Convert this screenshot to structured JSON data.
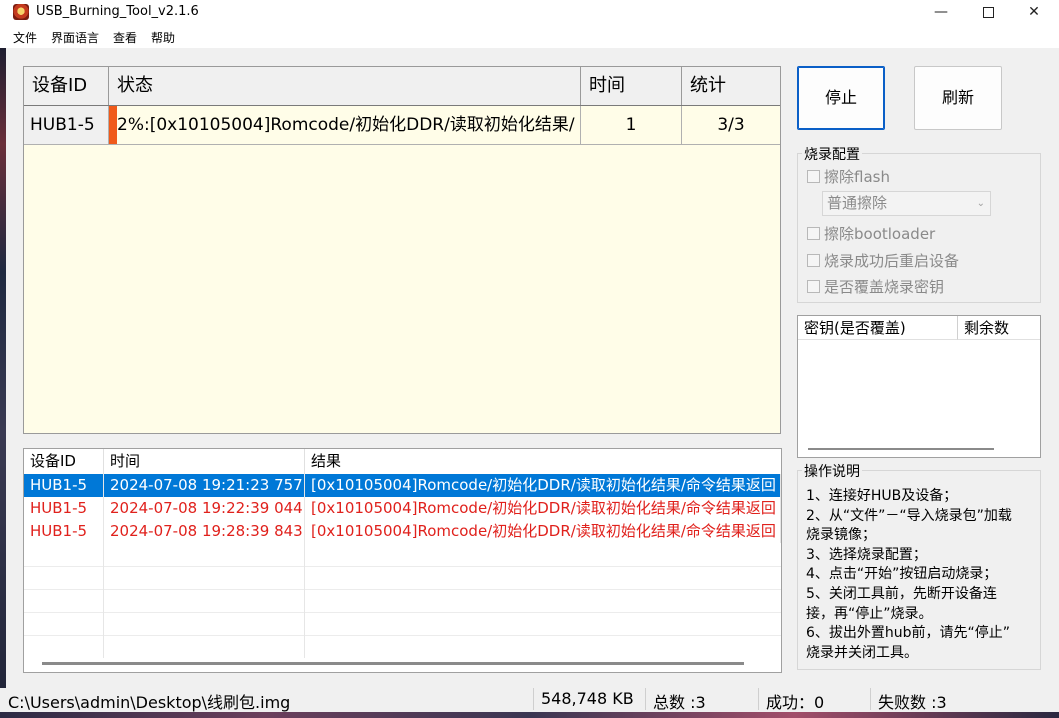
{
  "window": {
    "title": "USB_Burning_Tool_v2.1.6",
    "minimize": "—",
    "close": "✕"
  },
  "menu": [
    "文件",
    "界面语言",
    "查看",
    "帮助"
  ],
  "device_grid": {
    "headers": [
      "设备ID",
      "状态",
      "时间",
      "统计"
    ],
    "row": {
      "id": "HUB1-5",
      "status": "2%:[0x10105004]Romcode/初始化DDR/读取初始化结果/",
      "time": "1",
      "stats": "3/3"
    }
  },
  "buttons": {
    "stop": "停止",
    "refresh": "刷新"
  },
  "burn_config": {
    "title": "烧录配置",
    "erase_flash": "擦除flash",
    "erase_mode": "普通擦除",
    "erase_bootloader": "擦除bootloader",
    "reboot_after": "烧录成功后重启设备",
    "overwrite_key": "是否覆盖烧录密钥"
  },
  "key_table": {
    "headers": [
      "密钥(是否覆盖)",
      "剩余数"
    ]
  },
  "instructions": {
    "title": "操作说明",
    "lines": [
      "1、连接好HUB及设备；",
      "2、从“文件”－“导入烧录包”加载",
      "烧录镜像；",
      "3、选择烧录配置；",
      "4、点击“开始”按钮启动烧录；",
      "5、关闭工具前，先断开设备连",
      "接，再“停止”烧录。",
      "6、拔出外置hub前，请先“停止”",
      "烧录并关闭工具。"
    ]
  },
  "log": {
    "headers": [
      "设备ID",
      "时间",
      "结果"
    ],
    "rows": [
      {
        "id": "HUB1-5",
        "time": "2024-07-08 19:21:23 757",
        "result": "[0x10105004]Romcode/初始化DDR/读取初始化结果/命令结果返回"
      },
      {
        "id": "HUB1-5",
        "time": "2024-07-08 19:22:39 044",
        "result": "[0x10105004]Romcode/初始化DDR/读取初始化结果/命令结果返回"
      },
      {
        "id": "HUB1-5",
        "time": "2024-07-08 19:28:39 843",
        "result": "[0x10105004]Romcode/初始化DDR/读取初始化结果/命令结果返回"
      }
    ]
  },
  "status_bar": {
    "path": "C:\\Users\\admin\\Desktop\\线刷包.img",
    "size": "548,748 KB",
    "total": "总数 :3",
    "success": "成功：0",
    "fail": "失败数 :3"
  },
  "colors": {
    "selected_row": "#0078d7",
    "error_text": "#e0211c",
    "progress_mark": "#f05a1a",
    "grid_background": "#fffde8"
  }
}
